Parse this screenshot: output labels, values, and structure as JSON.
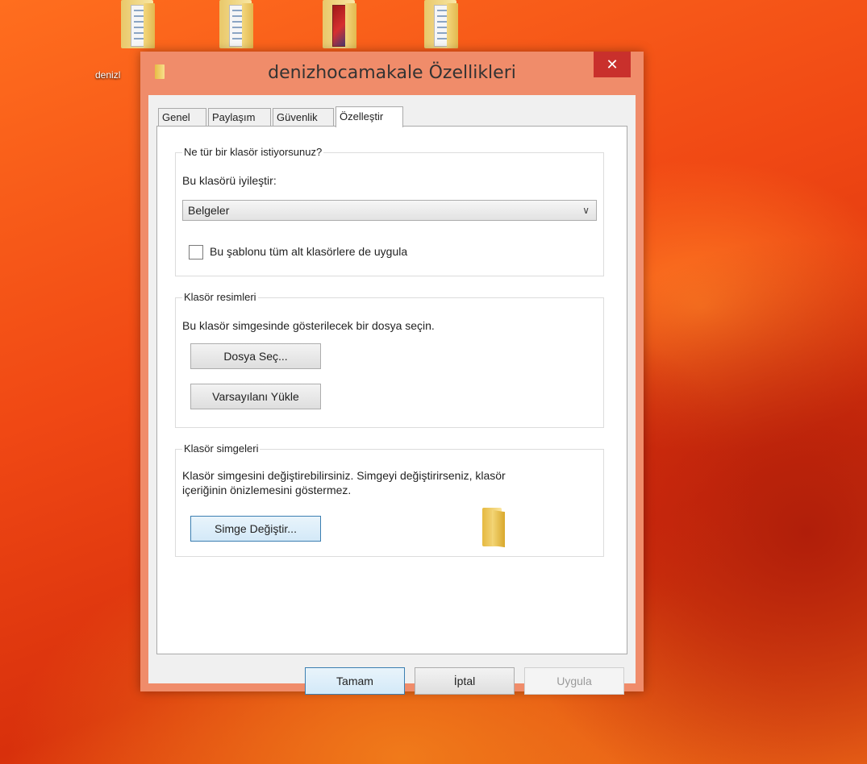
{
  "desktop": {
    "icons": [
      {
        "name": "folder-documents"
      },
      {
        "name": "folder-documents"
      },
      {
        "name": "folder-pictures"
      },
      {
        "name": "folder-documents"
      }
    ],
    "label": "denizl"
  },
  "dialog": {
    "title": "denizhocamakale Özellikleri",
    "close_symbol": "✕",
    "tabs": [
      {
        "label": "Genel",
        "active": false
      },
      {
        "label": "Paylaşım",
        "active": false
      },
      {
        "label": "Güvenlik",
        "active": false
      },
      {
        "label": "Özelleştir",
        "active": true
      }
    ],
    "folder_type": {
      "legend": "Ne tür bir klasör istiyorsunuz?",
      "optimize_label": "Bu klasörü iyileştir:",
      "selected": "Belgeler",
      "checkbox_label": "Bu şablonu tüm alt klasörlere de uygula",
      "checkbox_checked": false
    },
    "folder_pictures": {
      "legend": "Klasör resimleri",
      "description": "Bu klasör simgesinde gösterilecek bir dosya seçin.",
      "choose_file_button": "Dosya Seç...",
      "restore_default_button": "Varsayılanı Yükle"
    },
    "folder_icons": {
      "legend": "Klasör simgeleri",
      "description_line1": "Klasör simgesini değiştirebilirsiniz. Simgeyi değiştirirseniz, klasör",
      "description_line2": "içeriğinin önizlemesini göstermez.",
      "change_icon_button": "Simge Değiştir..."
    },
    "footer": {
      "ok_button": "Tamam",
      "cancel_button": "İptal",
      "apply_button": "Uygula"
    }
  },
  "colors": {
    "title_bar": "#f08c6a",
    "close_button": "#c9302c",
    "desktop_accent": "#f04814"
  }
}
